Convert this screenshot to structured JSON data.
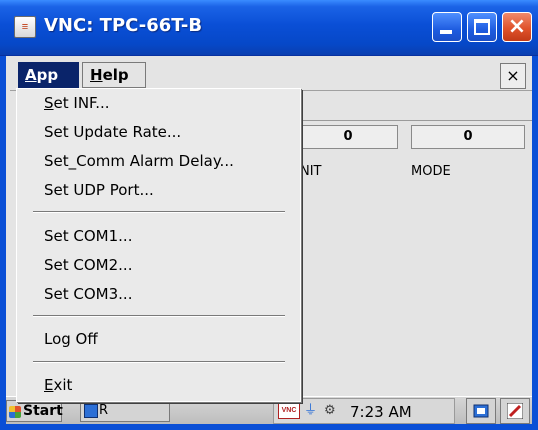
{
  "window": {
    "title": "VNC: TPC-66T-B"
  },
  "menubar": {
    "app": {
      "label": "App",
      "underline": "A",
      "rest": "pp"
    },
    "help": {
      "label": "Help",
      "underline": "H",
      "rest": "elp"
    },
    "close_glyph": "×"
  },
  "app_menu": {
    "items": [
      {
        "underline": "S",
        "rest": "et INF..."
      },
      {
        "underline": "",
        "rest": "Set Update Rate..."
      },
      {
        "underline": "",
        "rest": "Set_Comm Alarm Delay..."
      },
      {
        "underline": "",
        "rest": "Set UDP Port..."
      },
      {
        "underline": "",
        "rest": "Set COM1..."
      },
      {
        "underline": "",
        "rest": "Set COM2..."
      },
      {
        "underline": "",
        "rest": "Set COM3..."
      },
      {
        "underline": "",
        "rest": "Log Off"
      },
      {
        "underline": "E",
        "rest": "xit"
      }
    ]
  },
  "panel": {
    "unit_value": "0",
    "mode_value": "0",
    "unit_caption": "NIT",
    "mode_caption": "MODE"
  },
  "taskbar": {
    "start_label": "Start",
    "task_label": "R",
    "clock": "7:23 AM",
    "vnc_label": "VNC"
  }
}
